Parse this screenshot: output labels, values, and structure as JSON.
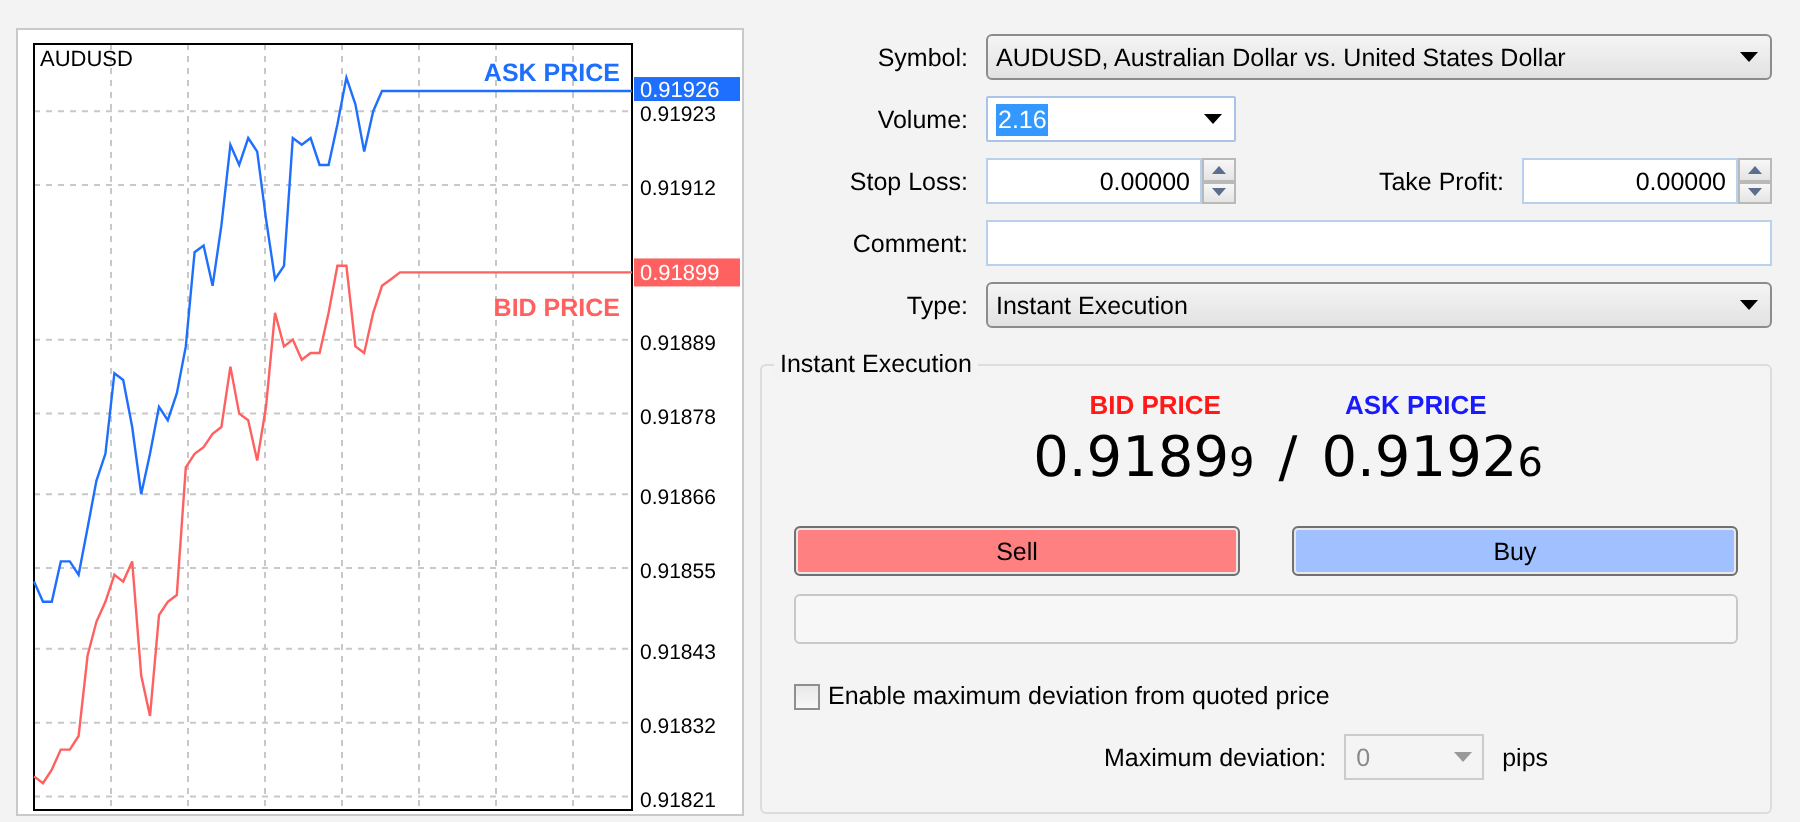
{
  "chart": {
    "symbol": "AUDUSD",
    "ask_tag": "0.91926",
    "bid_tag": "0.91899",
    "chart_data": {
      "type": "line",
      "categories": [
        null,
        null,
        null,
        null,
        null,
        null,
        null,
        null,
        null,
        null,
        null,
        null,
        null,
        null,
        null,
        null,
        null,
        null,
        null,
        null,
        null,
        null,
        null,
        null,
        null,
        null,
        null,
        null,
        null,
        null,
        null,
        null,
        null,
        null,
        null,
        null,
        null,
        null,
        null,
        null,
        null,
        null,
        null,
        null,
        null,
        null,
        null,
        null,
        null,
        null,
        null,
        null,
        null,
        null,
        null,
        null,
        null,
        null,
        null,
        null,
        null,
        null,
        null,
        null,
        null,
        null,
        null,
        null
      ],
      "series": [
        {
          "name": "ASK PRICE",
          "color": "#1f6fff",
          "values": [
            0.91853,
            0.9185,
            0.9185,
            0.91856,
            0.91856,
            0.91854,
            0.91861,
            0.91868,
            0.91872,
            0.91884,
            0.91883,
            0.91876,
            0.91866,
            0.91872,
            0.91879,
            0.91877,
            0.91881,
            0.91888,
            0.91902,
            0.91903,
            0.91897,
            0.91906,
            0.91918,
            0.91915,
            0.91919,
            0.91917,
            0.91907,
            0.91898,
            0.919,
            0.91919,
            0.91918,
            0.91919,
            0.91915,
            0.91915,
            0.91921,
            0.91928,
            0.91924,
            0.91917,
            0.91923,
            0.91926,
            0.91926,
            0.91926,
            0.91926,
            0.91926,
            0.91926,
            0.91926,
            0.91926,
            0.91926,
            0.91926,
            0.91926,
            0.91926,
            0.91926,
            0.91926,
            0.91926,
            0.91926,
            0.91926,
            0.91926,
            0.91926,
            0.91926,
            0.91926,
            0.91926,
            0.91926,
            0.91926,
            0.91926,
            0.91926,
            0.91926,
            0.91926,
            0.91926
          ]
        },
        {
          "name": "BID PRICE",
          "color": "#ff6060",
          "values": [
            0.91824,
            0.91823,
            0.91825,
            0.91828,
            0.91828,
            0.9183,
            0.91842,
            0.91847,
            0.9185,
            0.91854,
            0.91853,
            0.91856,
            0.91839,
            0.91833,
            0.91848,
            0.9185,
            0.91851,
            0.9187,
            0.91872,
            0.91873,
            0.91875,
            0.91876,
            0.91885,
            0.91878,
            0.91877,
            0.91871,
            0.91879,
            0.91893,
            0.91888,
            0.91889,
            0.91886,
            0.91887,
            0.91887,
            0.91893,
            0.919,
            0.919,
            0.91888,
            0.91887,
            0.91893,
            0.91897,
            0.91898,
            0.91899,
            0.91899,
            0.91899,
            0.91899,
            0.91899,
            0.91899,
            0.91899,
            0.91899,
            0.91899,
            0.91899,
            0.91899,
            0.91899,
            0.91899,
            0.91899,
            0.91899,
            0.91899,
            0.91899,
            0.91899,
            0.91899,
            0.91899,
            0.91899,
            0.91899,
            0.91899,
            0.91899,
            0.91899,
            0.91899,
            0.91899
          ]
        }
      ],
      "grid": true,
      "ylim": [
        0.91819,
        0.91933
      ],
      "yticks": [
        {
          "value": 0.91923,
          "label": "0.91923"
        },
        {
          "value": 0.91912,
          "label": "0.91912"
        },
        {
          "value": 0.91889,
          "label": "0.91889"
        },
        {
          "value": 0.91878,
          "label": "0.91878"
        },
        {
          "value": 0.91866,
          "label": "0.91866"
        },
        {
          "value": 0.91855,
          "label": "0.91855"
        },
        {
          "value": 0.91843,
          "label": "0.91843"
        },
        {
          "value": 0.91832,
          "label": "0.91832"
        },
        {
          "value": 0.91821,
          "label": "0.91821"
        }
      ]
    }
  },
  "order_form": {
    "symbol": {
      "label": "Symbol:",
      "value": "AUDUSD, Australian Dollar vs. United States Dollar"
    },
    "volume": {
      "label": "Volume:",
      "value": "2.16",
      "text_selected": true
    },
    "stop_loss": {
      "label": "Stop Loss:",
      "value": "0.00000"
    },
    "take_profit": {
      "label": "Take Profit:",
      "value": "0.00000"
    },
    "comment": {
      "label": "Comment:"
    },
    "type": {
      "label": "Type:",
      "value": "Instant Execution"
    }
  },
  "execution": {
    "title": "Instant Execution",
    "bid_label": "BID PRICE",
    "ask_label": "ASK PRICE",
    "bid_price": {
      "main": "0.9189",
      "last_digit": "9"
    },
    "separator": "/",
    "ask_price": {
      "main": "0.9192",
      "last_digit": "6"
    },
    "buttons": [
      {
        "label": "Sell",
        "color": "#ff8080"
      },
      {
        "label": "Buy",
        "color": "#a0c0ff"
      }
    ],
    "max_deviation_checkbox": {
      "label": "Enable maximum deviation from quoted price",
      "checked": false
    },
    "max_deviation": {
      "label": "Maximum deviation:",
      "value": "0",
      "disabled": true,
      "unit": "pips"
    }
  }
}
